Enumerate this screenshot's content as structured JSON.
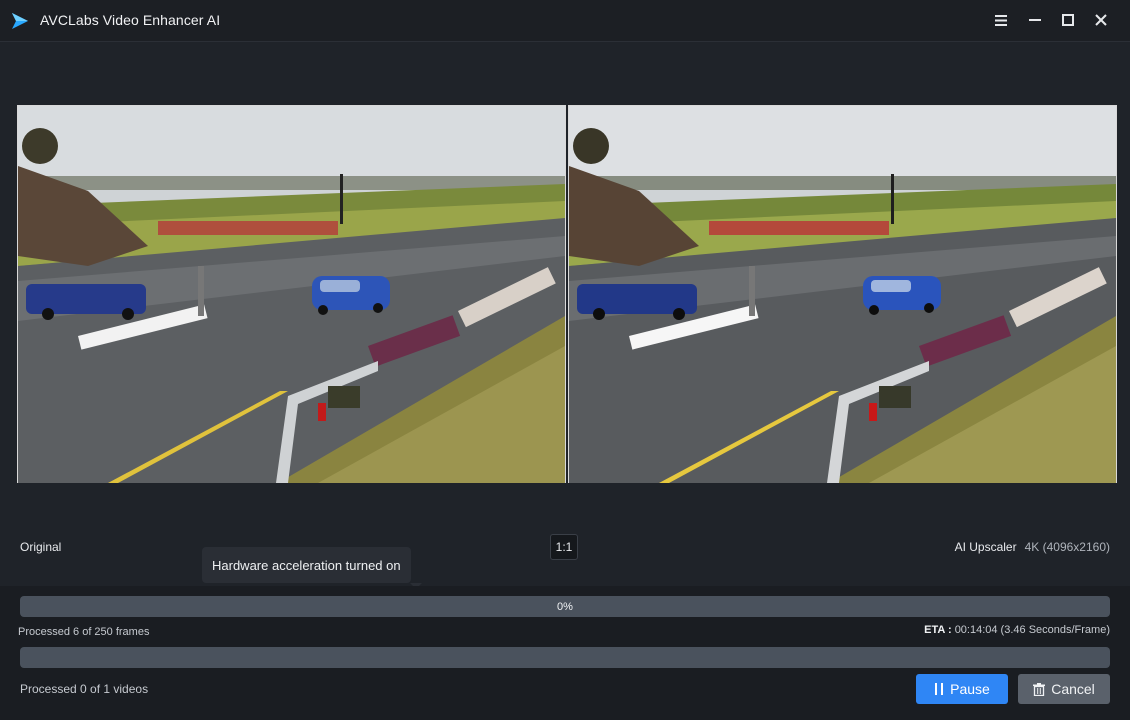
{
  "window": {
    "title": "AVCLabs Video Enhancer AI",
    "accent_color": "#2f86f5",
    "controls": {
      "menu_icon": "hamburger-menu-icon",
      "minimize_icon": "minimize-icon",
      "maximize_icon": "maximize-icon",
      "close_icon": "close-icon"
    }
  },
  "preview": {
    "left_label": "Original",
    "ratio_label": "1:1",
    "right_label": "AI Upscaler",
    "right_resolution": "4K (4096x2160)"
  },
  "tooltip": {
    "text": "Hardware acceleration turned on"
  },
  "progress": {
    "frames_percent_label": "0%",
    "frames_fraction": 0.0,
    "frames_text": "Processed 6 of 250 frames",
    "eta_label": "ETA :",
    "eta_value": "00:14:04 (3.46 Seconds/Frame)",
    "videos_fraction": 0.0,
    "videos_text": "Processed 0 of 1 videos"
  },
  "buttons": {
    "pause_label": "Pause",
    "pause_icon": "pause-icon",
    "cancel_label": "Cancel",
    "cancel_icon": "trash-icon"
  }
}
